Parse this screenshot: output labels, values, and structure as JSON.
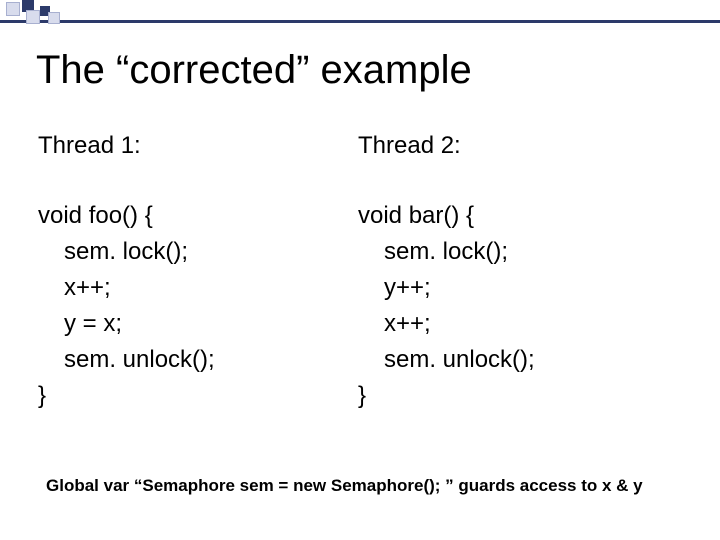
{
  "title": "The “corrected” example",
  "columns": {
    "left": {
      "header": "Thread 1:",
      "l0": "void foo() {",
      "l1": "sem. lock();",
      "l2": "x++;",
      "l3": "y = x;",
      "l4": "sem. unlock();",
      "l5": "}"
    },
    "right": {
      "header": "Thread 2:",
      "l0": "void bar() {",
      "l1": "sem. lock();",
      "l2": "y++;",
      "l3": "x++;",
      "l4": "sem. unlock();",
      "l5": "}"
    }
  },
  "footer": "Global var “Semaphore sem = new Semaphore(); ” guards access to x & y"
}
